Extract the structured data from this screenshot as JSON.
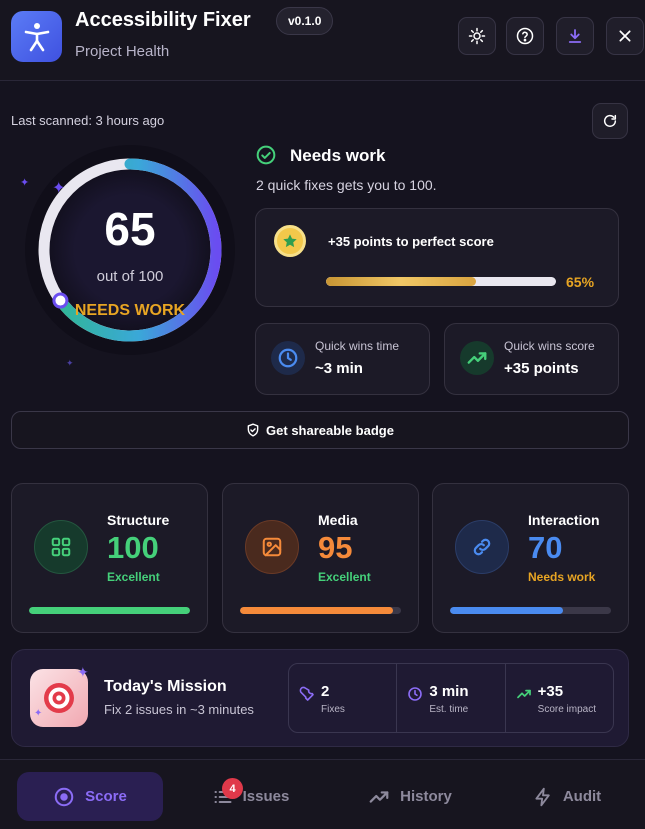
{
  "header": {
    "title": "Accessibility Fixer",
    "subtitle": "Project Health",
    "version": "v0.1.0",
    "buttons": [
      "settings-icon",
      "help-icon",
      "download-icon",
      "close-icon"
    ]
  },
  "scan": {
    "last_scanned": "Last scanned: 3 hours ago"
  },
  "score": {
    "value": "65",
    "out_of": "out of 100",
    "status": "NEEDS WORK",
    "fraction": 0.65
  },
  "status": {
    "title": "Needs work",
    "subtitle": "2 quick fixes gets you to 100."
  },
  "perfect": {
    "label": "+35 points to perfect score",
    "percent_text": "65%",
    "percent": 65
  },
  "quick_wins": {
    "time_label": "Quick wins time",
    "time_value": "~3 min",
    "score_label": "Quick wins score",
    "score_value": "+35 points"
  },
  "badge_button": "Get shareable badge",
  "categories": [
    {
      "name": "Structure",
      "score": "100",
      "rating": "Excellent",
      "fill": 100,
      "color": "#45d07a"
    },
    {
      "name": "Media",
      "score": "95",
      "rating": "Excellent",
      "fill": 95,
      "color": "#f58a3a"
    },
    {
      "name": "Interaction",
      "score": "70",
      "rating": "Needs work",
      "fill": 70,
      "color": "#4a8bf0"
    }
  ],
  "mission": {
    "title": "Today's Mission",
    "subtitle": "Fix 2 issues in ~3 minutes",
    "stats": [
      {
        "value": "2",
        "label": "Fixes"
      },
      {
        "value": "3 min",
        "label": "Est. time"
      },
      {
        "value": "+35",
        "label": "Score impact"
      }
    ]
  },
  "nav": {
    "items": [
      {
        "label": "Score",
        "active": true
      },
      {
        "label": "Issues",
        "badge": "4"
      },
      {
        "label": "History"
      },
      {
        "label": "Audit"
      }
    ]
  },
  "colors": {
    "accent": "#8b6cf6",
    "warning": "#e8a523",
    "success": "#45d07a"
  }
}
